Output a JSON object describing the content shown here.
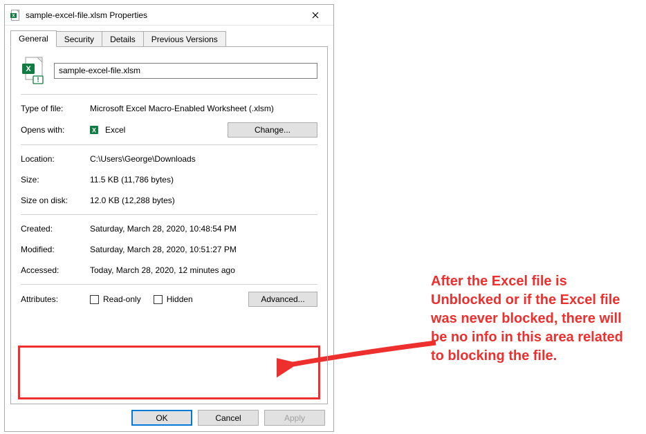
{
  "titlebar": {
    "title": "sample-excel-file.xlsm Properties"
  },
  "tabs": {
    "general": "General",
    "security": "Security",
    "details": "Details",
    "previous_versions": "Previous Versions"
  },
  "filename": "sample-excel-file.xlsm",
  "fields": {
    "type_of_file": {
      "label": "Type of file:",
      "value": "Microsoft Excel Macro-Enabled Worksheet (.xlsm)"
    },
    "opens_with": {
      "label": "Opens with:",
      "value": "Excel",
      "change_button": "Change..."
    },
    "location": {
      "label": "Location:",
      "value": "C:\\Users\\George\\Downloads"
    },
    "size": {
      "label": "Size:",
      "value": "11.5 KB (11,786 bytes)"
    },
    "size_on_disk": {
      "label": "Size on disk:",
      "value": "12.0 KB (12,288 bytes)"
    },
    "created": {
      "label": "Created:",
      "value": "Saturday, March 28, 2020, 10:48:54 PM"
    },
    "modified": {
      "label": "Modified:",
      "value": "Saturday, March 28, 2020, 10:51:27 PM"
    },
    "accessed": {
      "label": "Accessed:",
      "value": "Today, March 28, 2020, 12 minutes ago"
    },
    "attributes": {
      "label": "Attributes:",
      "readonly": "Read-only",
      "hidden": "Hidden",
      "advanced_button": "Advanced..."
    }
  },
  "buttons": {
    "ok": "OK",
    "cancel": "Cancel",
    "apply": "Apply"
  },
  "annotation_text": "After the Excel file is Unblocked or if the Excel file was never blocked, there will be no info in this area related to blocking the file."
}
